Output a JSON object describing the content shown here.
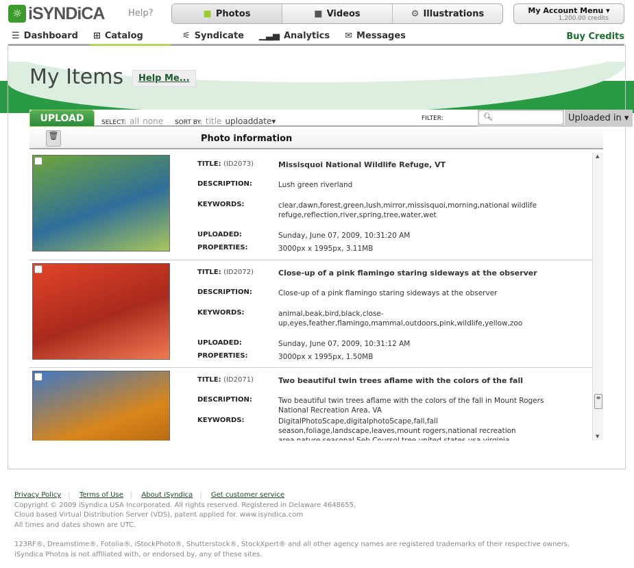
{
  "header": {
    "logo": "iSYNDiCA",
    "help": "Help?",
    "media_tabs": [
      {
        "label": "Photos",
        "icon": "camera-icon"
      },
      {
        "label": "Videos",
        "icon": "video-camera-icon"
      },
      {
        "label": "Illustrations",
        "icon": "illustration-icon"
      }
    ],
    "account": {
      "label": "My Account Menu ▾",
      "credits": "1,200.00 credits"
    }
  },
  "nav": {
    "items": [
      {
        "label": "Dashboard",
        "icon": "dashboard-icon"
      },
      {
        "label": "Catalog",
        "icon": "catalog-icon"
      },
      {
        "label": "Syndicate",
        "icon": "syndicate-icon"
      },
      {
        "label": "Analytics",
        "icon": "analytics-icon"
      },
      {
        "label": "Messages",
        "icon": "messages-icon"
      }
    ],
    "buy_credits": "Buy Credits"
  },
  "page": {
    "title": "My Items",
    "help_me": "Help Me..."
  },
  "toolbar": {
    "upload": "UPLOAD",
    "select_label": "SELECT:",
    "select_all": "all",
    "select_none": "none",
    "sort_label": "SORT BY:",
    "sort_title": "title",
    "sort_uploaddate": "uploaddate▾",
    "filter_label": "FILTER:",
    "filter_value": "",
    "uploaded_in": "Uploaded in ▾"
  },
  "table": {
    "header": "Photo information"
  },
  "labels": {
    "title": "TITLE:",
    "description": "DESCRIPTION:",
    "keywords": "KEYWORDS:",
    "uploaded": "UPLOADED:",
    "properties": "PROPERTIES:"
  },
  "items": [
    {
      "id": "(ID2073)",
      "title": "Missisquoi National Wildlife Refuge, VT",
      "description": "Lush green riverland",
      "keywords": "clear,dawn,forest,green,lush,mirror,missisquoi,morning,national wildlife refuge,reflection,river,spring,tree,water,wet",
      "uploaded": "Sunday, June 07, 2009, 10:31:20 AM",
      "properties": "3000px x 1995px, 3.11MB",
      "colors": [
        "#6fa63a",
        "#2f6e9a",
        "#a9c65a"
      ]
    },
    {
      "id": "(ID2072)",
      "title": "Close-up of a pink flamingo staring sideways at the observer",
      "description": "Close-up of a pink flamingo staring sideways at the observer",
      "keywords": "animal,beak,bird,black,close-up,eyes,feather,flamingo,mammal,outdoors,pink,wildlife,yellow,zoo",
      "uploaded": "Sunday, June 07, 2009, 10:31:12 AM",
      "properties": "3000px x 1995px, 1.50MB",
      "colors": [
        "#e2442a",
        "#a92a1c",
        "#f07a55"
      ]
    },
    {
      "id": "(ID2071)",
      "title": "Two beautiful twin trees aflame with the colors of the fall",
      "description": "Two beautiful twin trees aflame with the colors of the fall in Mount Rogers National Recreation Area, VA",
      "keywords": "DigitalPhotoScape,digitalphotoScape,fall,fall season,foliage,landscape,leaves,mount rogers,national recreation area,nature,seasonal,Seb Coursol,tree,united states,usa,virginia",
      "uploaded": "",
      "properties": "",
      "colors": [
        "#3f78c4",
        "#d9861a",
        "#a85a10"
      ]
    }
  ],
  "footer": {
    "links": [
      "Privacy Policy",
      "Terms of Use",
      "About iSyndica",
      "Get customer service"
    ],
    "lines": [
      "Copyright © 2009 iSyndica USA Incorporated. All rights reserved. Registered in Delaware 4648655.",
      "Cloud based Virtual Distribution Server (VDS), patent applied for. www.isyndica.com",
      "All times and dates shown are UTC."
    ],
    "trademarks": [
      "123RF®, Dreamstime®, Fotolia®, iStockPhoto®, Shutterstock®, StockXpert® and all other agency names are registered trademarks of their respective owners.",
      "iSyndica Photos is not affiliated with, or endorsed by, any of these sites."
    ]
  }
}
